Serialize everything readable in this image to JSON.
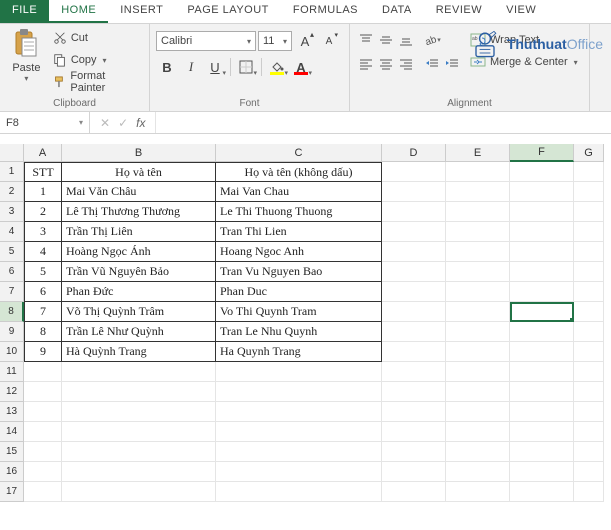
{
  "tabs": {
    "file": "FILE",
    "home": "HOME",
    "insert": "INSERT",
    "pagelayout": "PAGE LAYOUT",
    "formulas": "FORMULAS",
    "data": "DATA",
    "review": "REVIEW",
    "view": "VIEW"
  },
  "clipboard": {
    "paste": "Paste",
    "cut": "Cut",
    "copy": "Copy",
    "fmtpainter": "Format Painter",
    "group": "Clipboard"
  },
  "font": {
    "name": "Calibri",
    "size": "11",
    "group": "Font"
  },
  "alignment": {
    "wrap": "Wrap Text",
    "merge": "Merge & Center",
    "group": "Alignment"
  },
  "watermark": {
    "brand": "Thuthuat",
    "suffix": "Office"
  },
  "fxbar": {
    "cellref": "F8"
  },
  "cols": [
    "A",
    "B",
    "C",
    "D",
    "E",
    "F",
    "G"
  ],
  "headers": {
    "stt": "STT",
    "hoten": "Họ và tên",
    "hoten_kd": "Họ và tên (không dấu)"
  },
  "rows": [
    {
      "stt": "1",
      "b": "Mai Văn Châu",
      "c": "Mai Van Chau"
    },
    {
      "stt": "2",
      "b": "Lê Thị Thương Thương",
      "c": "Le Thi Thuong Thuong"
    },
    {
      "stt": "3",
      "b": "Trần Thị Liên",
      "c": "Tran Thi Lien"
    },
    {
      "stt": "4",
      "b": "Hoàng Ngọc Ánh",
      "c": "Hoang Ngoc Anh"
    },
    {
      "stt": "5",
      "b": "Trần Vũ Nguyên Bảo",
      "c": "Tran Vu Nguyen Bao"
    },
    {
      "stt": "6",
      "b": "Phan Đức",
      "c": "Phan Duc"
    },
    {
      "stt": "7",
      "b": "Võ Thị Quỳnh Trâm",
      "c": "Vo Thi Quynh Tram"
    },
    {
      "stt": "8",
      "b": "Trần Lê Như Quỳnh",
      "c": "Tran Le Nhu Quynh"
    },
    {
      "stt": "9",
      "b": "Hà Quỳnh Trang",
      "c": "Ha Quynh Trang"
    }
  ]
}
